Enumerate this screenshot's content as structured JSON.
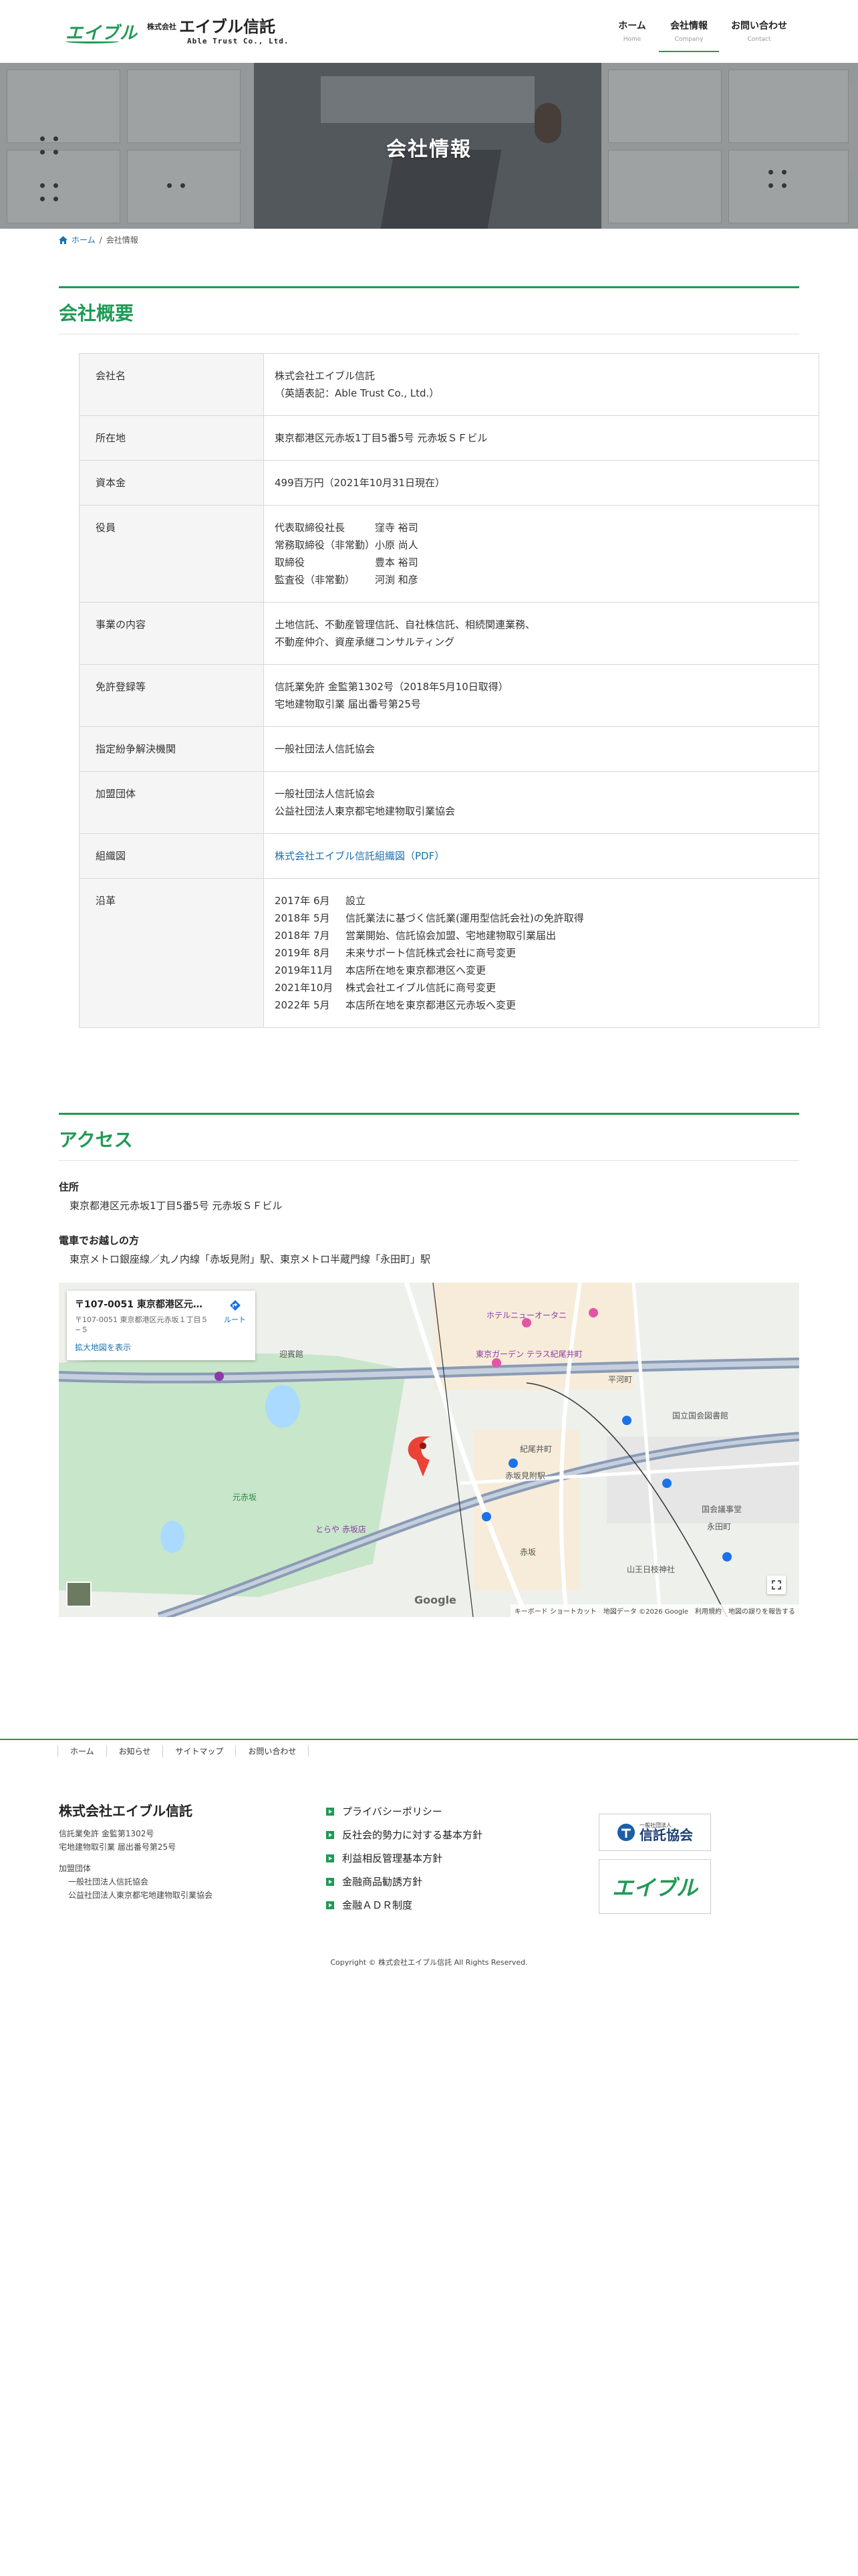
{
  "header": {
    "logo_mark": "エイブル",
    "logo_kabu": "株式会社",
    "logo_name": "エイブル信託",
    "logo_en": "Able Trust Co., Ltd.",
    "nav": [
      {
        "label": "ホーム",
        "sub": "Home"
      },
      {
        "label": "会社情報",
        "sub": "Company"
      },
      {
        "label": "お問い合わせ",
        "sub": "Contact"
      }
    ]
  },
  "hero": {
    "title": "会社情報"
  },
  "breadcrumb": {
    "home": "ホーム",
    "separator": "/",
    "current": "会社情報"
  },
  "overview": {
    "heading": "会社概要",
    "rows": {
      "company_name": {
        "label": "会社名",
        "line1": "株式会社エイブル信託",
        "line2": "（英語表記：Able Trust Co., Ltd.）"
      },
      "address": {
        "label": "所在地",
        "value": "東京都港区元赤坂1丁目5番5号 元赤坂ＳＦビル"
      },
      "capital": {
        "label": "資本金",
        "value": "499百万円（2021年10月31日現在）"
      },
      "officers": {
        "label": "役員",
        "items": [
          {
            "role": "代表取締役社長",
            "name": "窪寺 裕司"
          },
          {
            "role": "常務取締役（非常勤）",
            "name": "小原 尚人"
          },
          {
            "role": "取締役",
            "name": "豊本 裕司"
          },
          {
            "role": "監査役（非常勤）",
            "name": "河渕 和彦"
          }
        ]
      },
      "business": {
        "label": "事業の内容",
        "line1": "土地信託、不動産管理信託、自社株信託、相続関連業務、",
        "line2": "不動産仲介、資産承継コンサルティング"
      },
      "license": {
        "label": "免許登録等",
        "line1": "信託業免許 金監第1302号（2018年5月10日取得）",
        "line2": "宅地建物取引業 届出番号第25号"
      },
      "dispute": {
        "label": "指定紛争解決機関",
        "value": "一般社団法人信託協会"
      },
      "membership": {
        "label": "加盟団体",
        "line1": "一般社団法人信託協会",
        "line2": "公益社団法人東京都宅地建物取引業協会"
      },
      "org_chart": {
        "label": "組織図",
        "link": "株式会社エイブル信託組織図（PDF）"
      },
      "history": {
        "label": "沿革",
        "items": [
          {
            "date": "2017年 6月",
            "event": "設立"
          },
          {
            "date": "2018年 5月",
            "event": "信託業法に基づく信託業(運用型信託会社)の免許取得"
          },
          {
            "date": "2018年 7月",
            "event": "営業開始、信託協会加盟、宅地建物取引業届出"
          },
          {
            "date": "2019年 8月",
            "event": "未来サポート信託株式会社に商号変更"
          },
          {
            "date": "2019年11月",
            "event": "本店所在地を東京都港区へ変更"
          },
          {
            "date": "2021年10月",
            "event": "株式会社エイブル信託に商号変更"
          },
          {
            "date": "2022年 5月",
            "event": "本店所在地を東京都港区元赤坂へ変更"
          }
        ]
      }
    }
  },
  "access": {
    "heading": "アクセス",
    "address_label": "住所",
    "address_value": "東京都港区元赤坂1丁目5番5号 元赤坂ＳＦビル",
    "train_label": "電車でお越しの方",
    "train_value": "東京メトロ銀座線／丸ノ内線「赤坂見附」駅、東京メトロ半蔵門線「永田町」駅"
  },
  "map": {
    "card_title": "〒107-0051 東京都港区元赤坂...",
    "card_address": "〒107-0051 東京都港区元赤坂１丁目５−５",
    "card_link": "拡大地図を表示",
    "route_label": "ルート",
    "google": "Google",
    "attribution": "キーボード ショートカット　地図データ ©2026 Google　利用規約　地図の誤りを報告する",
    "labels": {
      "hibiya": "迎賓館",
      "garden": "元赤坂",
      "akasaka_mitsuke": "赤坂見附駅",
      "nagatacho": "永田町",
      "hirakawacho": "平河町",
      "library": "国立国会図書館",
      "garden_terrace": "東京ガーデン テラス紀尾井町",
      "new_otani": "ホテルニューオータニ",
      "kokkai": "国会議事堂",
      "kioicho": "紀尾井町",
      "akasaka": "赤坂",
      "toraya": "とらや 赤坂店",
      "sanno": "山王日枝神社"
    }
  },
  "footer": {
    "nav": [
      "ホーム",
      "お知らせ",
      "サイトマップ",
      "お問い合わせ"
    ],
    "company_name": "株式会社エイブル信託",
    "license1": "信託業免許 金監第1302号",
    "license2": "宅地建物取引業 届出番号第25号",
    "membership_label": "加盟団体",
    "membership1": "一般社団法人信託協会",
    "membership2": "公益社団法人東京都宅地建物取引業協会",
    "links": [
      "プライバシーポリシー",
      "反社会的勢力に対する基本方針",
      "利益相反管理基本方針",
      "金融商品勧誘方針",
      "金融ＡＤＲ制度"
    ],
    "banner1_small": "一般社団法人",
    "banner1_name": "信託協会",
    "banner2_name": "エイブル",
    "copyright": "Copyright © 株式会社エイブル信託 All Rights Reserved."
  },
  "colors": {
    "accent": "#1f9a55",
    "link": "#1a6fb0"
  }
}
